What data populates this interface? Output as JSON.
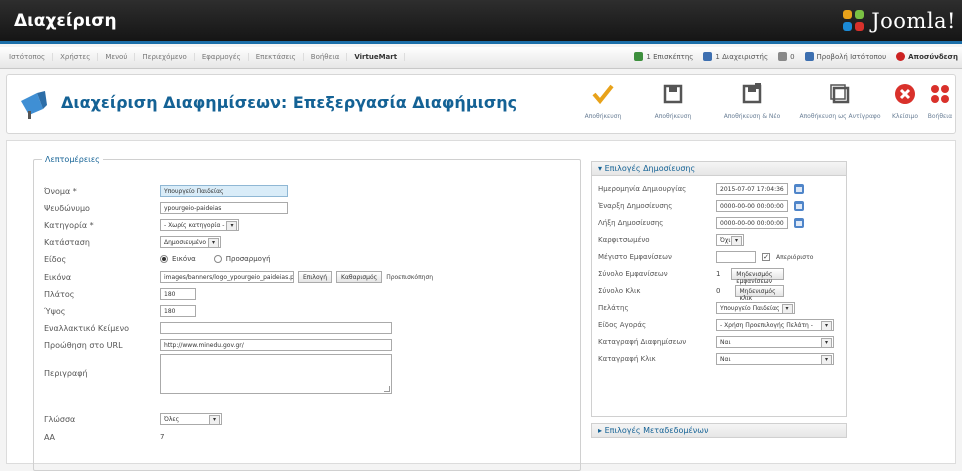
{
  "header": {
    "title": "Διαχείριση",
    "logo_text": "Joomla!"
  },
  "menubar": {
    "items": [
      "Ιστότοπος",
      "Χρήστες",
      "Μενού",
      "Περιεχόμενο",
      "Εφαρμογές",
      "Επεκτάσεις",
      "Βοήθεια",
      "VirtueMart"
    ],
    "right": [
      {
        "label": "1 Επισκέπτης",
        "icon": "users-icon",
        "color": "#3d8f3d"
      },
      {
        "label": "1 Διαχειριστής",
        "icon": "admin-icon",
        "color": "#3d6fb0"
      },
      {
        "label": "0",
        "icon": "mail-icon",
        "color": "#888888"
      },
      {
        "label": "Προβολή Ιστότοπου",
        "icon": "site-icon",
        "color": "#3d6fb0"
      },
      {
        "label": "Αποσύνδεση",
        "icon": "logout-icon",
        "color": "#cc2222"
      }
    ]
  },
  "toolbar": {
    "page_title": "Διαχείριση Διαφημίσεων: Επεξεργασία Διαφήμισης",
    "buttons": [
      {
        "label": "Αποθήκευση",
        "icon": "check-icon",
        "color": "#e8a21a"
      },
      {
        "label": "Αποθήκευση",
        "icon": "save-icon",
        "color": "#555555"
      },
      {
        "label": "Αποθήκευση & Νέο",
        "icon": "save-new-icon",
        "color": "#555555"
      },
      {
        "label": "Αποθήκευση ως Αντίγραφο",
        "icon": "save-copy-icon",
        "color": "#555555"
      },
      {
        "label": "Κλείσιμο",
        "icon": "close-icon",
        "color": "#d9312b"
      },
      {
        "label": "Βοήθεια",
        "icon": "help-icon",
        "color": "#d9312b"
      }
    ]
  },
  "details": {
    "legend": "Λεπτομέρειες",
    "name_label": "Όνομα *",
    "name_value": "Υπουργείο Παιδείας",
    "alias_label": "Ψευδώνυμο",
    "alias_value": "ypourgeio-paideias",
    "category_label": "Κατηγορία *",
    "category_value": "- Χωρίς κατηγορία -",
    "status_label": "Κατάσταση",
    "status_value": "Δημοσιευμένο",
    "type_label": "Είδος",
    "type_image": "Εικόνα",
    "type_custom": "Προσαρμογή",
    "image_label": "Εικόνα",
    "image_value": "images/banners/logo_ypourgeio_paideias.png",
    "image_select": "Επιλογή",
    "image_clear": "Καθαρισμός",
    "image_preview": "Προεπισκόπηση",
    "width_label": "Πλάτος",
    "width_value": "180",
    "height_label": "Ύψος",
    "height_value": "180",
    "alt_label": "Εναλλακτικό Κείμενο",
    "alt_value": "",
    "url_label": "Προώθηση στο URL",
    "url_value": "http://www.minedu.gov.gr/",
    "desc_label": "Περιγραφή",
    "lang_label": "Γλώσσα",
    "lang_value": "Όλες",
    "id_label": "ΑΑ",
    "id_value": "7"
  },
  "publish": {
    "heading": "Επιλογές Δημοσίευσης",
    "created_label": "Ημερομηνία Δημιουργίας",
    "created_value": "2015-07-07 17:04:36",
    "start_label": "Έναρξη Δημοσίευσης",
    "start_value": "0000-00-00 00:00:00",
    "finish_label": "Λήξη Δημοσίευσης",
    "finish_value": "0000-00-00 00:00:00",
    "sticky_label": "Καρφιτσωμένο",
    "sticky_value": "Όχι",
    "max_imp_label": "Μέγιστο Εμφανίσεων",
    "max_imp_value": "",
    "unlimited_label": "Απεριόριστο",
    "total_imp_label": "Σύνολο Εμφανίσεων",
    "total_imp_value": "1",
    "reset_imp": "Μηδενισμός εμφανίσεων",
    "total_clicks_label": "Σύνολο Κλικ",
    "total_clicks_value": "0",
    "reset_clicks": "Μηδενισμός κλικ",
    "client_label": "Πελάτης",
    "client_value": "Υπουργείο Παιδείας",
    "purchase_label": "Είδος Αγοράς",
    "purchase_value": "- Χρήση Προεπιλογής Πελάτη -",
    "track_imp_label": "Καταγραφή Διαφημίσεων",
    "track_imp_value": "Ναι",
    "track_clicks_label": "Καταγραφή Κλικ",
    "track_clicks_value": "Ναι"
  },
  "metadata": {
    "heading": "Επιλογές Μεταδεδομένων"
  }
}
